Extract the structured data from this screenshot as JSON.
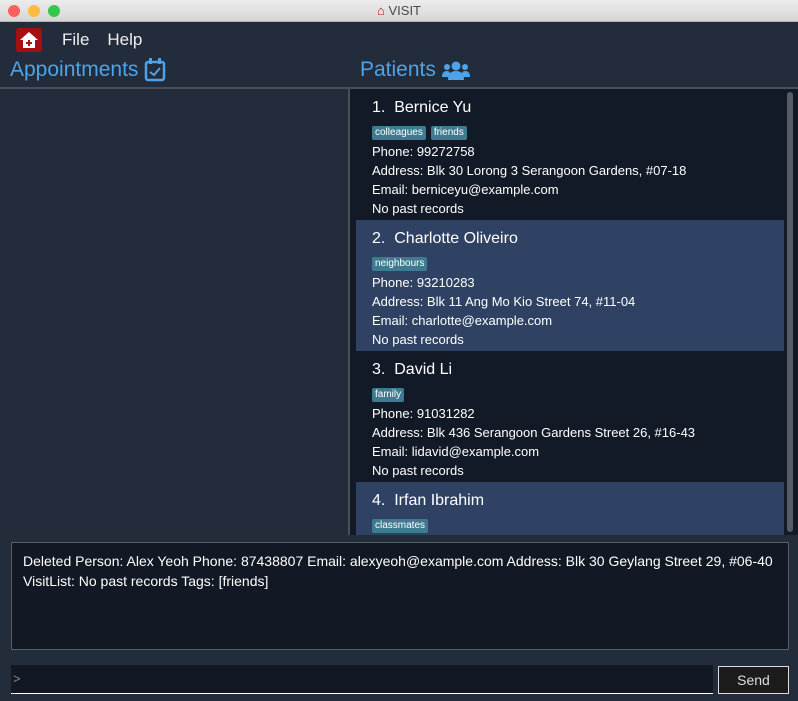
{
  "window": {
    "title": "VISIT"
  },
  "menu": {
    "file": "File",
    "help": "Help"
  },
  "appointments": {
    "title": "Appointments"
  },
  "patients": {
    "title": "Patients",
    "items": [
      {
        "index": "1.",
        "name": "Bernice Yu",
        "tags": [
          "colleagues",
          "friends"
        ],
        "phone": "Phone: 99272758",
        "address": "Address: Blk 30 Lorong 3 Serangoon Gardens, #07-18",
        "email": "Email: berniceyu@example.com",
        "records": "No past records"
      },
      {
        "index": "2.",
        "name": "Charlotte Oliveiro",
        "tags": [
          "neighbours"
        ],
        "phone": "Phone: 93210283",
        "address": "Address: Blk 11 Ang Mo Kio Street 74, #11-04",
        "email": "Email: charlotte@example.com",
        "records": "No past records"
      },
      {
        "index": "3.",
        "name": "David Li",
        "tags": [
          "family"
        ],
        "phone": "Phone: 91031282",
        "address": "Address: Blk 436 Serangoon Gardens Street 26, #16-43",
        "email": "Email: lidavid@example.com",
        "records": "No past records"
      },
      {
        "index": "4.",
        "name": "Irfan Ibrahim",
        "tags": [
          "classmates"
        ]
      }
    ]
  },
  "result": "Deleted Person: Alex Yeoh Phone: 87438807 Email: alexyeoh@example.com Address: Blk 30 Geylang Street 29, #06-40 VisitList: No past records Tags: [friends]",
  "command": {
    "prompt": ">",
    "value": ""
  },
  "send": "Send"
}
